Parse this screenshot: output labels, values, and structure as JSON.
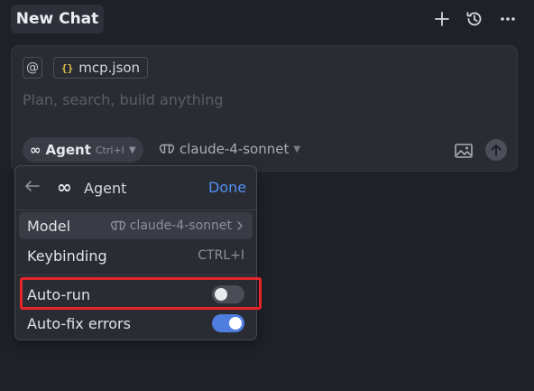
{
  "header": {
    "title": "New Chat",
    "icons": [
      "plus-icon",
      "history-icon",
      "more-icon"
    ]
  },
  "composer": {
    "mention_symbol": "@",
    "file_chip_icon": "{}",
    "file_chip_label": "mcp.json",
    "placeholder": "Plan, search, build anything",
    "agent_symbol": "∞",
    "agent_label": "Agent",
    "agent_shortcut": "Ctrl+I",
    "model_label": "claude-4-sonnet"
  },
  "agent_menu": {
    "title": "Agent",
    "done_label": "Done",
    "rows": {
      "model": {
        "label": "Model",
        "value": "claude-4-sonnet"
      },
      "keybinding": {
        "label": "Keybinding",
        "value": "CTRL+I"
      },
      "auto_run": {
        "label": "Auto-run",
        "enabled": false
      },
      "auto_fix": {
        "label": "Auto-fix errors",
        "enabled": true
      }
    }
  },
  "colors": {
    "background": "#1f2128",
    "accent_blue": "#4f8ff0",
    "highlight_red": "#e5252b"
  }
}
